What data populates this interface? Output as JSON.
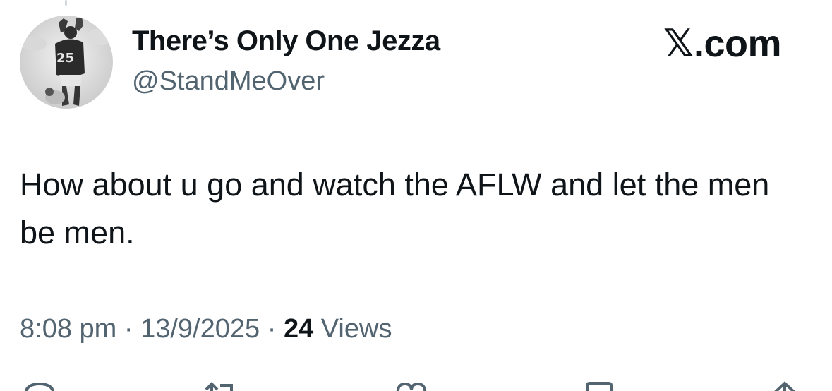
{
  "author": {
    "display_name": "There’s Only One Jezza",
    "handle": "@StandMeOver",
    "avatar_jersey_number": "25"
  },
  "brand": {
    "label": "𝕏.com"
  },
  "tweet": {
    "text": "How about u go and watch the AFLW and let the men be men."
  },
  "meta": {
    "time": "8:08 pm",
    "separator_1": " · ",
    "date": "13/9/2025",
    "separator_2": " · ",
    "views_count": "24",
    "views_label": " Views"
  },
  "actions": [
    {
      "icon": "reply-icon"
    },
    {
      "icon": "retweet-icon"
    },
    {
      "icon": "like-icon"
    },
    {
      "icon": "bookmark-icon"
    },
    {
      "icon": "share-icon"
    }
  ],
  "colors": {
    "text_primary": "#0f1419",
    "text_secondary": "#536471"
  }
}
